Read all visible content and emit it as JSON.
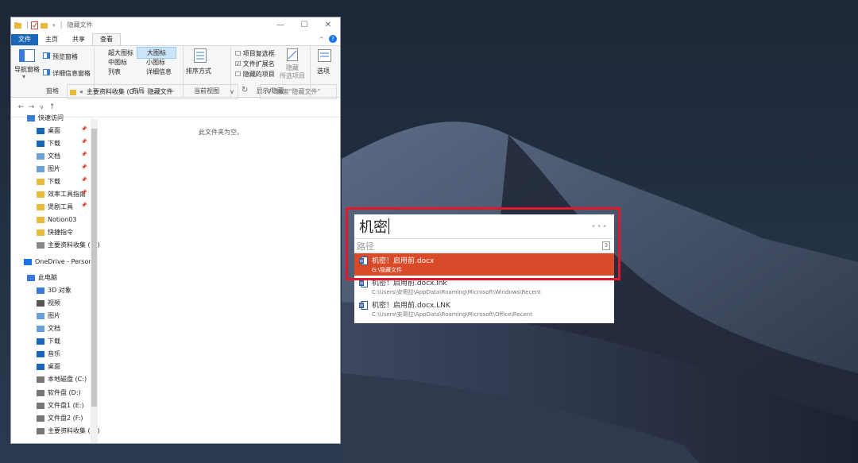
{
  "explorer": {
    "title": "隐藏文件",
    "tabs": [
      "文件",
      "主页",
      "共享",
      "查看"
    ],
    "ribbon": {
      "pane": {
        "nav_pane": "导航窗格",
        "preview": "预览窗格",
        "details": "详细信息窗格",
        "label": "窗格"
      },
      "layout": {
        "xlarge": "超大图标",
        "large": "大图标",
        "medium": "中图标",
        "small": "小图标",
        "list": "列表",
        "details": "详细信息",
        "label": "布局"
      },
      "current_view": {
        "sort": "排序方式",
        "label": "当前视图"
      },
      "show_hide": {
        "item_checkbox": "项目复选框",
        "file_ext": "文件扩展名",
        "hidden_items": "隐藏的项目",
        "hide_selected": "隐藏",
        "hide_selected2": "所选项目",
        "label": "显示/隐藏"
      },
      "options": "选项"
    },
    "address": {
      "prefix": "«",
      "drive": "主要资料收集 (G:)",
      "sep": "›",
      "folder": "隐藏文件"
    },
    "search_placeholder": "搜索\"隐藏文件\"",
    "empty_text": "此文件夹为空。",
    "nav": [
      {
        "label": "快速访问"
      },
      {
        "label": "桌面"
      },
      {
        "label": "下载"
      },
      {
        "label": "文档"
      },
      {
        "label": "图片"
      },
      {
        "label": "下载"
      },
      {
        "label": "效率工具指南"
      },
      {
        "label": "煲剧工具"
      },
      {
        "label": "Notion03"
      },
      {
        "label": "快捷指令"
      },
      {
        "label": "主要资料收集 (G:)"
      },
      {
        "label": "OneDrive - Person"
      },
      {
        "label": "此电脑"
      },
      {
        "label": "3D 对象"
      },
      {
        "label": "视频"
      },
      {
        "label": "图片"
      },
      {
        "label": "文档"
      },
      {
        "label": "下载"
      },
      {
        "label": "音乐"
      },
      {
        "label": "桌面"
      },
      {
        "label": "本地磁盘 (C:)"
      },
      {
        "label": "软件盘 (D:)"
      },
      {
        "label": "文件盘1 (E:)"
      },
      {
        "label": "文件盘2 (F:)"
      },
      {
        "label": "主要资料收集 (G:)"
      }
    ]
  },
  "launcher": {
    "query": "机密",
    "more": "•••",
    "path_label": "路径",
    "result_count": "3",
    "results": [
      {
        "name": "机密！启用前.docx",
        "path": "G:\\隐藏文件"
      },
      {
        "name": "机密！启用前.docx.lnk",
        "path": "C:\\Users\\安哥拉\\AppData\\Roaming\\Microsoft\\Windows\\Recent"
      },
      {
        "name": "机密！启用前.docx.LNK",
        "path": "C:\\Users\\安哥拉\\AppData\\Roaming\\Microsoft\\Office\\Recent"
      }
    ],
    "colors": {
      "selected": "#db4a28",
      "highlight_box": "#e1182a"
    }
  }
}
